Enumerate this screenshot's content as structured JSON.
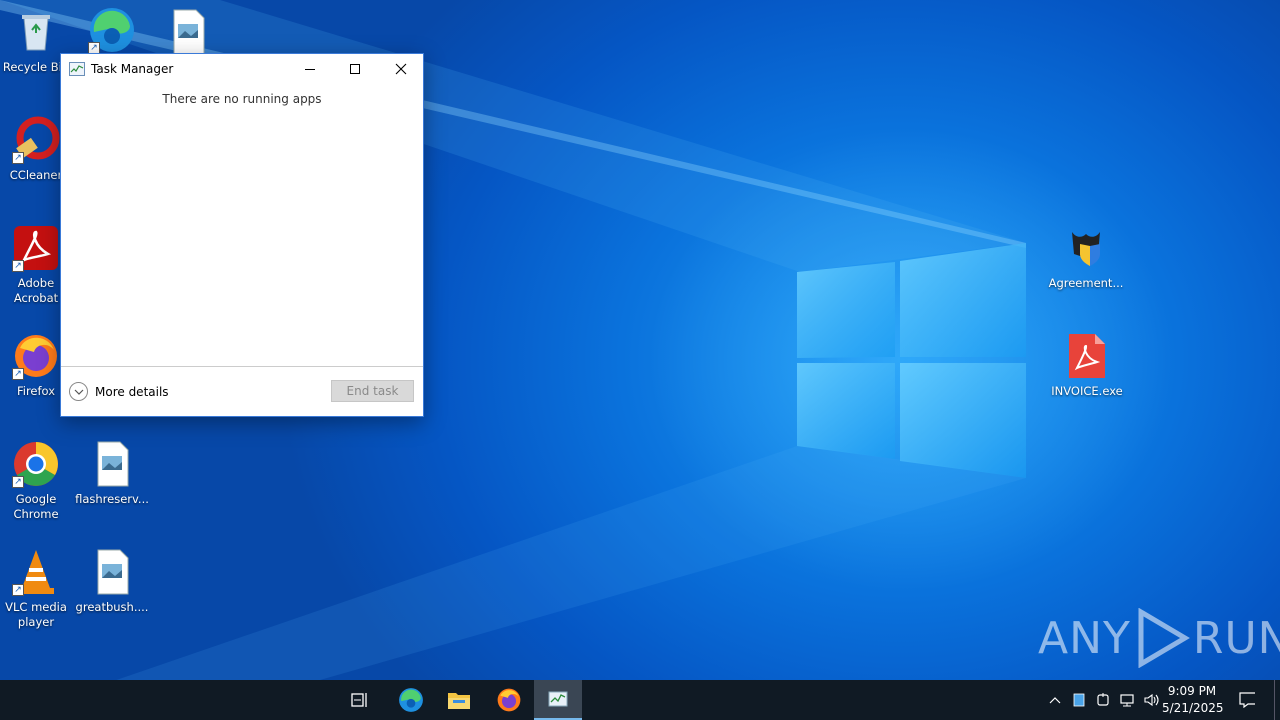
{
  "desktop": {
    "icons": [
      {
        "label": "Recycle Bin",
        "icon": "recycle-bin-icon"
      },
      {
        "label": "",
        "icon": "edge-icon"
      },
      {
        "label": "",
        "icon": "image-file-icon"
      },
      {
        "label": "CCleaner",
        "icon": "ccleaner-icon"
      },
      {
        "label": "Adobe Acrobat",
        "icon": "acrobat-icon"
      },
      {
        "label": "Firefox",
        "icon": "firefox-icon"
      },
      {
        "label": "Google Chrome",
        "icon": "chrome-icon"
      },
      {
        "label": "flashreserv...",
        "icon": "image-file-icon"
      },
      {
        "label": "VLC media player",
        "icon": "vlc-icon"
      },
      {
        "label": "greatbush....",
        "icon": "image-file-icon"
      },
      {
        "label": "Agreement...",
        "icon": "agreement-icon"
      },
      {
        "label": "INVOICE.exe",
        "icon": "invoice-exe-icon"
      }
    ]
  },
  "task_manager": {
    "title": "Task Manager",
    "message": "There are no running apps",
    "more_details_label": "More details",
    "end_task_label": "End task"
  },
  "taskbar": {
    "pinned": [
      "task-view-icon",
      "edge-icon",
      "file-explorer-icon",
      "firefox-icon",
      "task-manager-icon"
    ],
    "clock": {
      "time": "9:09 PM",
      "date": "5/21/2025"
    }
  },
  "watermark": {
    "text_left": "ANY",
    "text_right": "RUN"
  },
  "colors": {
    "accent": "#0a72dc",
    "taskbar": "#101a24"
  }
}
